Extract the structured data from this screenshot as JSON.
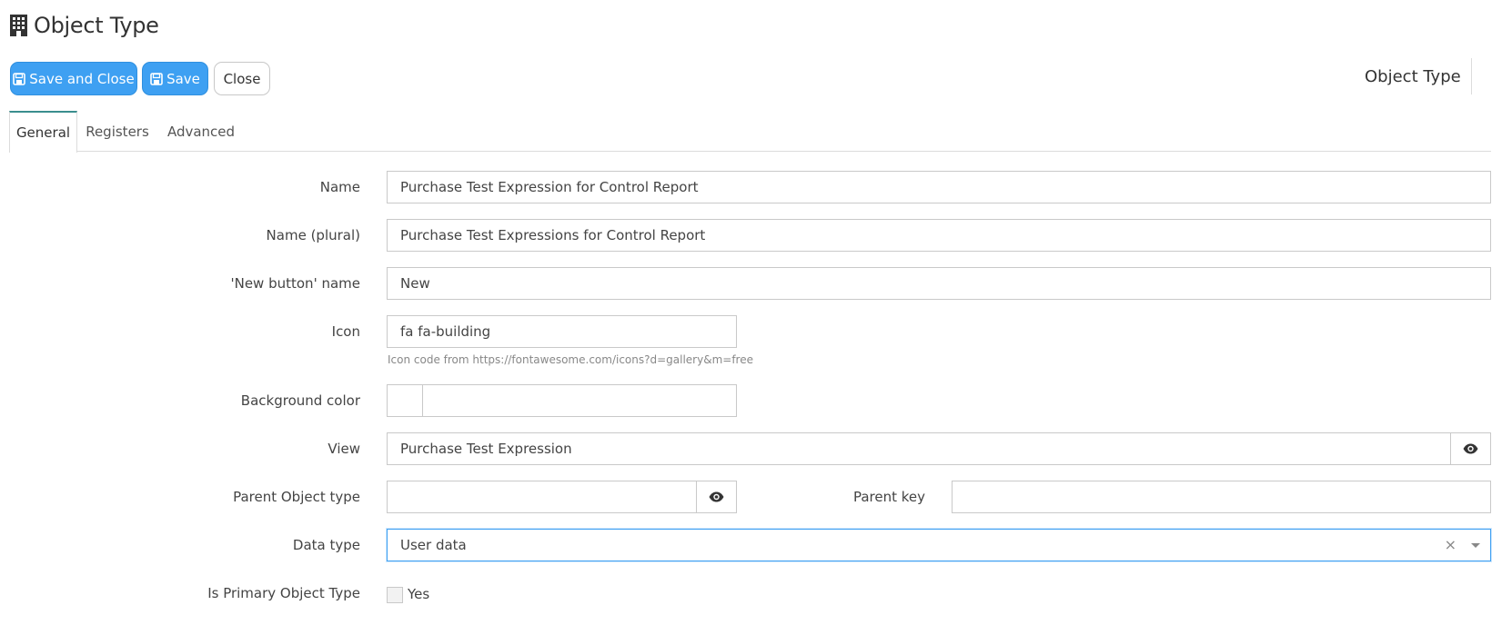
{
  "header": {
    "title": "Object Type",
    "title_icon": "building-icon"
  },
  "toolbar": {
    "save_and_close_label": "Save and Close",
    "save_label": "Save",
    "close_label": "Close",
    "save_icon": "floppy-disk-icon",
    "right_title": "Object Type"
  },
  "tabs": [
    {
      "label": "General",
      "active": true
    },
    {
      "label": "Registers",
      "active": false
    },
    {
      "label": "Advanced",
      "active": false
    }
  ],
  "form": {
    "name": {
      "label": "Name",
      "value": "Purchase Test Expression for Control Report"
    },
    "name_plural": {
      "label": "Name (plural)",
      "value": "Purchase Test Expressions for Control Report"
    },
    "new_button_name": {
      "label": "'New button' name",
      "value": "New"
    },
    "icon": {
      "label": "Icon",
      "value": "fa fa-building",
      "help": "Icon code from https://fontawesome.com/icons?d=gallery&m=free"
    },
    "background_color": {
      "label": "Background color",
      "value": ""
    },
    "view": {
      "label": "View",
      "value": "Purchase Test Expression"
    },
    "parent_object_type": {
      "label": "Parent Object type",
      "value": ""
    },
    "parent_key": {
      "label": "Parent key",
      "value": ""
    },
    "data_type": {
      "label": "Data type",
      "value": "User data"
    },
    "is_primary": {
      "label": "Is Primary Object Type",
      "checkbox_label": "Yes",
      "checked": false
    }
  },
  "colors": {
    "primary": "#3ea0f2",
    "tab_accent": "#3a8e8e",
    "focus": "#3ea0f2"
  }
}
